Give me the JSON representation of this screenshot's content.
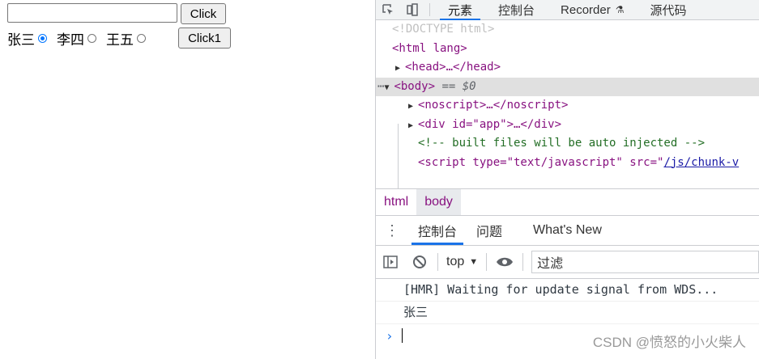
{
  "page": {
    "input_value": "",
    "click_label": "Click",
    "radios": [
      {
        "label": "张三",
        "checked": true
      },
      {
        "label": "李四",
        "checked": false
      },
      {
        "label": "王五",
        "checked": false
      }
    ],
    "click1_label": "Click1"
  },
  "devtools": {
    "tabs": [
      "元素",
      "控制台",
      "Recorder",
      "源代码"
    ],
    "active_tab": "元素",
    "dom": {
      "doctype": "<!DOCTYPE html>",
      "html_open": "<html lang>",
      "head": "<head>…</head>",
      "body": "<body>",
      "body_suffix": "== $0",
      "noscript": "<noscript>…</noscript>",
      "div": "<div id=\"app\">…</div>",
      "comment": "<!-- built files will be auto injected -->",
      "script_prefix": "<script type=\"text/javascript\" src=\"",
      "script_src": "/js/chunk-v"
    },
    "breadcrumbs": [
      "html",
      "body"
    ],
    "drawer_tabs": [
      "控制台",
      "问题",
      "What's New"
    ],
    "context": "top",
    "filter_placeholder": "过滤",
    "console_messages": [
      "[HMR] Waiting for update signal from WDS...",
      "张三"
    ],
    "prompt": "›"
  },
  "watermark": "CSDN @愤怒的小火柴人",
  "colors": {
    "accent": "#1a73e8",
    "tag": "#881280",
    "radio": "#0075ff"
  }
}
